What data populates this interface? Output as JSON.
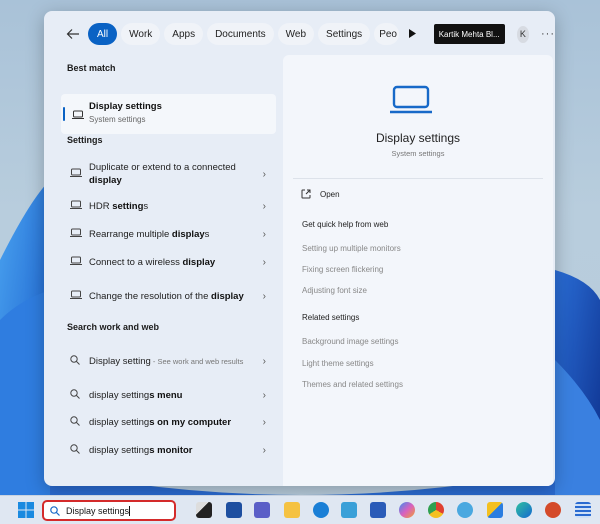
{
  "flyout": {
    "filters": [
      {
        "label": "All",
        "active": true
      },
      {
        "label": "Work"
      },
      {
        "label": "Apps"
      },
      {
        "label": "Documents"
      },
      {
        "label": "Web"
      },
      {
        "label": "Settings"
      },
      {
        "label": "Peo"
      }
    ],
    "org_label": "Kartik Mehta Bl...",
    "avatar_initial": "K",
    "more_label": "···"
  },
  "left": {
    "best_match_title": "Best match",
    "best_match": {
      "title": "Display settings",
      "subtitle": "System settings"
    },
    "settings_title": "Settings",
    "settings_items": [
      {
        "pre": "Duplicate or extend to a connected ",
        "bold": "display",
        "post": ""
      },
      {
        "pre": "HDR ",
        "bold": "setting",
        "post": "s"
      },
      {
        "pre": "Rearrange multiple ",
        "bold": "display",
        "post": "s"
      },
      {
        "pre": "Connect to a wireless ",
        "bold": "display",
        "post": ""
      },
      {
        "pre": "Change the resolution of the ",
        "bold": "display",
        "post": ""
      }
    ],
    "web_title": "Search work and web",
    "web_items": [
      {
        "pre": "Display setting",
        "bold": "",
        "post": "",
        "sub": " - See work and web results"
      },
      {
        "pre": "display setting",
        "bold": "s menu",
        "post": ""
      },
      {
        "pre": "display setting",
        "bold": "s on my computer",
        "post": ""
      },
      {
        "pre": "display setting",
        "bold": "s monitor",
        "post": ""
      }
    ]
  },
  "right": {
    "title": "Display settings",
    "subtitle": "System settings",
    "open_label": "Open",
    "help_title": "Get quick help from web",
    "help_links": [
      "Setting up multiple monitors",
      "Fixing screen flickering",
      "Adjusting font size"
    ],
    "related_title": "Related settings",
    "related_links": [
      "Background image settings",
      "Light theme settings",
      "Themes and related settings"
    ]
  },
  "taskbar": {
    "search_value": "Display settings",
    "apps": [
      "Task View",
      "Microsoft Store",
      "Microsoft Teams",
      "File Explorer",
      "Get Help",
      "mydgr",
      "Microsoft Word",
      "Copilot",
      "Google Chrome",
      "Weather",
      "OneDrive",
      "Microsoft Edge",
      "Microsoft PowerPoint",
      "Notepad"
    ]
  },
  "colors": {
    "accent": "#0a62c4",
    "highlight_border": "#d42a2a"
  }
}
